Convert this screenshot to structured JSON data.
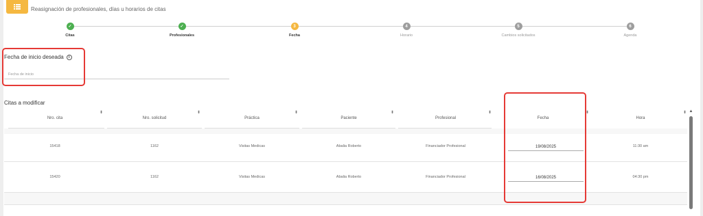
{
  "header": {
    "title": "Reasignación de profesionales, días u horarios de citas",
    "icon": "list-icon",
    "accent": "#f5b841"
  },
  "stepper": {
    "steps": [
      {
        "label": "Citas",
        "status": "done",
        "mark": "✓"
      },
      {
        "label": "Profesionales",
        "status": "done",
        "mark": "✓"
      },
      {
        "label": "Fecha",
        "status": "current",
        "mark": "3"
      },
      {
        "label": "Horario",
        "status": "pending",
        "mark": "4"
      },
      {
        "label": "Cambios solicitados",
        "status": "pending",
        "mark": "5"
      },
      {
        "label": "Agenda",
        "status": "pending",
        "mark": "6"
      }
    ]
  },
  "date_section": {
    "title": "Fecha de inicio deseada",
    "info_icon": "i",
    "placeholder": "Fecha de inicio"
  },
  "table": {
    "title": "Citas a modificar",
    "columns": [
      "Nro. cita",
      "Nro. solicitud",
      "Práctica",
      "Paciente",
      "Profesional",
      "Fecha",
      "Hora"
    ],
    "sort_glyph": "⬍",
    "rows": [
      {
        "cita": "15418",
        "solicitud": "1162",
        "practica": "Visitas Medicas",
        "paciente": "Abalia Roberto",
        "profesional": "Financiador Profesional",
        "fecha": "19/08/2025",
        "hora": "11:30 am"
      },
      {
        "cita": "15420",
        "solicitud": "1162",
        "practica": "Visitas Medicas",
        "paciente": "Abalia Roberto",
        "profesional": "Financiador Profesional",
        "fecha": "16/08/2025",
        "hora": "04:30 pm"
      }
    ]
  },
  "colors": {
    "done": "#4caf50",
    "current": "#f5b841",
    "pending": "#9e9e9e",
    "highlight": "#e53935"
  }
}
